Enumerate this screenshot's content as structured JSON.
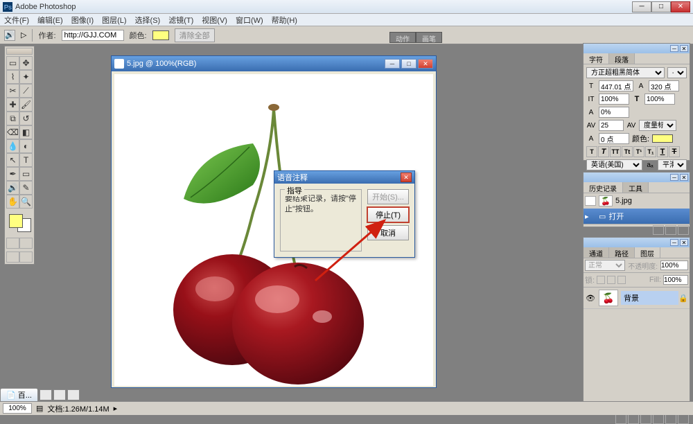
{
  "app_title": "Adobe Photoshop",
  "menubar": {
    "items": [
      "文件(F)",
      "编辑(E)",
      "图像(I)",
      "图层(L)",
      "选择(S)",
      "滤镜(T)",
      "视图(V)",
      "窗口(W)",
      "帮助(H)"
    ]
  },
  "optionsbar": {
    "author_label": "作者:",
    "author_value": "http://GJJ.COM",
    "color_label": "颜色:",
    "clear_btn": "清除全部"
  },
  "right_action_tabs": [
    "动作",
    "画笔"
  ],
  "document": {
    "title": "5.jpg @ 100%(RGB)"
  },
  "dialog": {
    "title": "语音注释",
    "group_title": "指导",
    "message": "要结束记录，请按\"停止\"按钮。",
    "btn_start": "开始(S)...",
    "btn_stop": "停止(T)",
    "btn_cancel": "取消"
  },
  "char_panel": {
    "tabs": [
      "字符",
      "段落"
    ],
    "font_family": "方正超粗黑简体",
    "font_style": "-",
    "font_size": "447.01 点",
    "leading": "320 点",
    "vscale": "100%",
    "hscale": "100%",
    "tracking": "0%",
    "kerning": "25",
    "metrics_label": "度量标准",
    "baseline": "0 点",
    "color_label": "颜色:",
    "style_buttons": [
      "T",
      "T",
      "TT",
      "Tt",
      "T",
      "T",
      "T"
    ],
    "lang": "英语(美国)",
    "aa_label": "aₐ",
    "aa_value": "平滑"
  },
  "history_panel": {
    "tabs": [
      "历史记录",
      "工具"
    ],
    "snapshot_label": "5.jpg",
    "state_label": "打开"
  },
  "layers_panel": {
    "tabs": [
      "通道",
      "路径",
      "图层"
    ],
    "blend_mode": "正常",
    "opacity_label": "不透明度:",
    "opacity_value": "100%",
    "lock_label": "锁:",
    "fill_label": "Fill:",
    "fill_value": "100%",
    "layer_name": "背景"
  },
  "status_tab": "百...",
  "statusbar": {
    "zoom": "100%",
    "doc_info": "文档:1.26M/1.14M"
  }
}
